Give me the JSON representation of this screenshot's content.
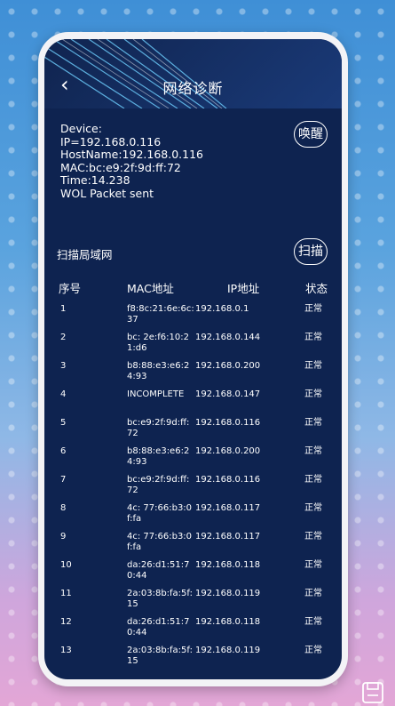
{
  "header": {
    "title": "网络诊断",
    "back_icon": "back-arrow-icon"
  },
  "device_info": {
    "lines": [
      "Device:",
      "IP=192.168.0.116",
      "HostName:192.168.0.116",
      "MAC:bc:e9:2f:9d:ff:72",
      "Time:14.238",
      "WOL Packet sent"
    ],
    "wake_button": "唤醒"
  },
  "scan": {
    "title": "扫描局域网",
    "scan_button": "扫描"
  },
  "table": {
    "columns": [
      "序号",
      "MAC地址",
      "IP地址",
      "状态"
    ],
    "rows": [
      {
        "idx": "1",
        "mac": "f8:8c:21:6e:6c:37",
        "ip": "192.168.0.1",
        "status": "正常"
      },
      {
        "idx": "2",
        "mac": "bc: 2e:f6:10:21:d6",
        "ip": "192.168.0.144",
        "status": "正常"
      },
      {
        "idx": "3",
        "mac": "b8:88:e3:e6:24:93",
        "ip": "192.168.0.200",
        "status": "正常"
      },
      {
        "idx": "4",
        "mac": "INCOMPLETE",
        "ip": "192.168.0.147",
        "status": "正常"
      },
      {
        "idx": "5",
        "mac": "bc:e9:2f:9d:ff:72",
        "ip": "192.168.0.116",
        "status": "正常"
      },
      {
        "idx": "6",
        "mac": "b8:88:e3:e6:24:93",
        "ip": "192.168.0.200",
        "status": "正常"
      },
      {
        "idx": "7",
        "mac": "bc:e9:2f:9d:ff:72",
        "ip": "192.168.0.116",
        "status": "正常"
      },
      {
        "idx": "8",
        "mac": "4c: 77:66:b3:0f:fa",
        "ip": "192.168.0.117",
        "status": "正常"
      },
      {
        "idx": "9",
        "mac": "4c: 77:66:b3:0f:fa",
        "ip": "192.168.0.117",
        "status": "正常"
      },
      {
        "idx": "10",
        "mac": "da:26:d1:51:70:44",
        "ip": "192.168.0.118",
        "status": "正常"
      },
      {
        "idx": "11",
        "mac": "2a:03:8b:fa:5f:15",
        "ip": "192.168.0.119",
        "status": "正常"
      },
      {
        "idx": "12",
        "mac": "da:26:d1:51:70:44",
        "ip": "192.168.0.118",
        "status": "正常"
      },
      {
        "idx": "13",
        "mac": "2a:03:8b:fa:5f:15",
        "ip": "192.168.0.119",
        "status": "正常"
      }
    ]
  },
  "overlay": {
    "save_icon": "save-icon"
  }
}
